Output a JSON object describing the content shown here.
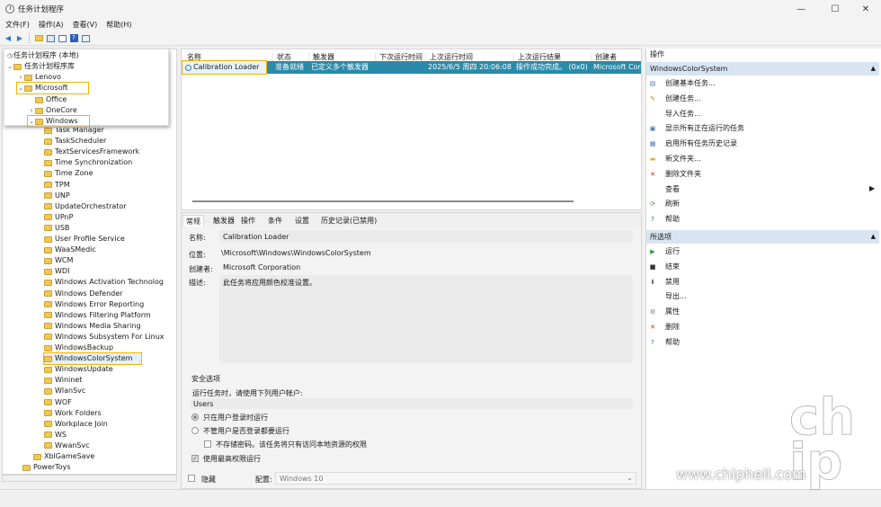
{
  "window": {
    "title": "任务计划程序",
    "minimize": "—",
    "maximize": "☐",
    "close": "✕"
  },
  "menu": [
    "文件(F)",
    "操作(A)",
    "查看(V)",
    "帮助(H)"
  ],
  "tree": {
    "root": "任务计划程序 (本地)",
    "library": "任务计划程序库",
    "popup_items": [
      "Lenovo",
      "Microsoft",
      "Office",
      "OneCore",
      "Windows"
    ],
    "items": [
      "Task Manager",
      "TaskScheduler",
      "TextServicesFramework",
      "Time Synchronization",
      "Time Zone",
      "TPM",
      "UNP",
      "UpdateOrchestrator",
      "UPnP",
      "USB",
      "User Profile Service",
      "WaaSMedic",
      "WCM",
      "WDI",
      "Windows Activation Technolog",
      "Windows Defender",
      "Windows Error Reporting",
      "Windows Filtering Platform",
      "Windows Media Sharing",
      "Windows Subsystem For Linux",
      "WindowsBackup",
      "WindowsColorSystem",
      "WindowsUpdate",
      "Wininet",
      "WlanSvc",
      "WOF",
      "Work Folders",
      "Workplace Join",
      "WS",
      "WwanSvc"
    ],
    "after": [
      "XblGameSave",
      "PowerToys"
    ],
    "selected": "WindowsColorSystem"
  },
  "tasklist": {
    "columns": [
      "名称",
      "状态",
      "触发器",
      "下次运行时间",
      "上次运行时间",
      "上次运行结果",
      "创建者"
    ],
    "row": {
      "name": "Calibration Loader",
      "status": "准备就绪",
      "trigger": "已定义多个触发器",
      "next": "",
      "last": "2025/6/5 周四 20:06:08",
      "result": "操作成功完成。 (0x0)",
      "author": "Microsoft Cor"
    }
  },
  "details": {
    "tabs": [
      "常规",
      "触发器",
      "操作",
      "条件",
      "设置",
      "历史记录(已禁用)"
    ],
    "name_label": "名称:",
    "name_value": "Calibration Loader",
    "location_label": "位置:",
    "location_value": "\\Microsoft\\Windows\\WindowsColorSystem",
    "author_label": "创建者:",
    "author_value": "Microsoft Corporation",
    "desc_label": "描述:",
    "desc_value": "此任务将应用颜色校准设置。",
    "security_title": "安全选项",
    "run_as_label": "运行任务时，请使用下列用户帐户:",
    "run_as_value": "Users",
    "opt1": "只在用户登录时运行",
    "opt2": "不管用户是否登录都要运行",
    "opt3": "不存储密码。该任务将只有访问本地资源的权限",
    "opt4": "使用最高权限运行",
    "hidden_label": "隐藏",
    "config_label": "配置:",
    "config_value": "Windows 10"
  },
  "actions": {
    "header": "操作",
    "section1": "WindowsColorSystem",
    "items1": [
      "创建基本任务...",
      "创建任务...",
      "导入任务...",
      "显示所有正在运行的任务",
      "启用所有任务历史记录",
      "新文件夹...",
      "删除文件夹",
      "查看",
      "刷新",
      "帮助"
    ],
    "section2": "所选项",
    "items2": [
      "运行",
      "结束",
      "禁用",
      "导出...",
      "属性",
      "删除",
      "帮助"
    ]
  },
  "watermark": {
    "logo": "chip hell",
    "url": "www.chiphell.com"
  }
}
